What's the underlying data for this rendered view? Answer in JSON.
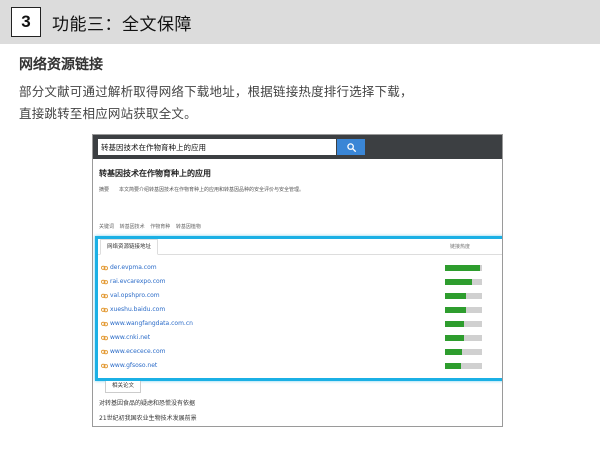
{
  "slide": {
    "number": "3",
    "title": "功能三：全文保障"
  },
  "section": {
    "heading": "网络资源链接",
    "desc_line1": "部分文献可通过解析取得网络下载地址，根据链接热度排行选择下载，",
    "desc_line2": "直接跳转至相应网站获取全文。"
  },
  "screen": {
    "search": {
      "value": "转基因技术在作物育种上的应用",
      "button_icon": "search-icon"
    },
    "paper_title": "转基因技术在作物育种上的应用",
    "abstract_label": "摘要",
    "abstract_text": "本文简要介绍转基因技术在作物育种上的应用和转基因品种的安全评价与安全管理。",
    "keywords_label": "关键词",
    "keywords": [
      "转基因技术",
      "作物育种",
      "转基因植物"
    ],
    "links_tab": "网络资源链接地址",
    "heat_header": "链接热度",
    "links": [
      {
        "url": "der.evpma.com",
        "heat": 0.95
      },
      {
        "url": "rai.evcarexpo.com",
        "heat": 0.72
      },
      {
        "url": "val.opshpro.com",
        "heat": 0.56
      },
      {
        "url": "xueshu.baidu.com",
        "heat": 0.56
      },
      {
        "url": "www.wangfangdata.com.cn",
        "heat": 0.5
      },
      {
        "url": "www.cnki.net",
        "heat": 0.5
      },
      {
        "url": "www.ececece.com",
        "heat": 0.47
      },
      {
        "url": "www.gfsoso.net",
        "heat": 0.42
      }
    ],
    "related_tab": "相关论文",
    "related": [
      "对转基因食品的疑虑和恐慌没有依据",
      "21世纪初我国农业生物技术发展前景"
    ]
  },
  "colors": {
    "header_bg": "#dcdcdc",
    "topbar_bg": "#3c3f42",
    "search_button": "#3a86d6",
    "panel_border": "#1bb0e5",
    "link": "#2a6bc8",
    "heat_fill": "#2e9d2e",
    "heat_track": "#d0d0d0"
  }
}
